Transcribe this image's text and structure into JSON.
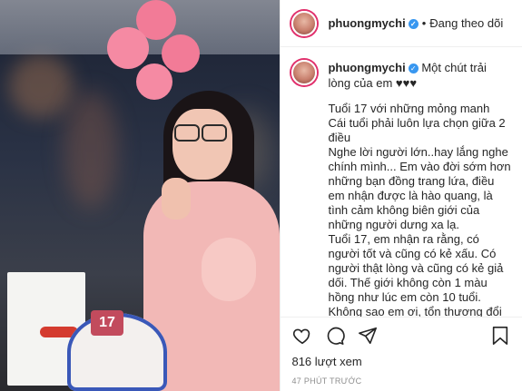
{
  "header": {
    "username": "phuongmychi",
    "verified_glyph": "✓",
    "separator": "•",
    "follow_status": "Đang theo dõi"
  },
  "caption": {
    "username": "phuongmychi",
    "verified_glyph": "✓",
    "text": "Một chút trải lòng của em ♥♥♥",
    "body": "Tuổi 17 với những mỏng manh\nCái tuổi phải luôn lựa chọn giữa 2 điều\nNghe lời người lớn..hay lắng nghe chính mình... Em vào đời sớm hơn những bạn đồng trang lứa, điều em nhận được là hào quang, là tình cảm không biên giới của những người dưng xa lạ.\nTuổi 17, em nhận ra rằng, có người tốt và cũng có kẻ xấu. Có người thật lòng và cũng có kẻ giả dối. Thế giới không còn 1 màu hồng như lúc em còn 10 tuổi.\nKhông sao em ơi, tổn thương đổi lấy cho ta món quà là sự tinh khôn. Đó là hành trang giúp em nhiều trên con"
  },
  "actions": {
    "icons": [
      "heart-icon",
      "comment-icon",
      "share-icon",
      "bookmark-icon"
    ]
  },
  "stats": {
    "views": "816 lượt xem",
    "time": "47 PHÚT TRƯỚC"
  },
  "photo": {
    "cake_number": "17",
    "cake_color": "#c24b5d",
    "dress_color": "#f2b8b6",
    "balloon_color": "#f27b97"
  }
}
